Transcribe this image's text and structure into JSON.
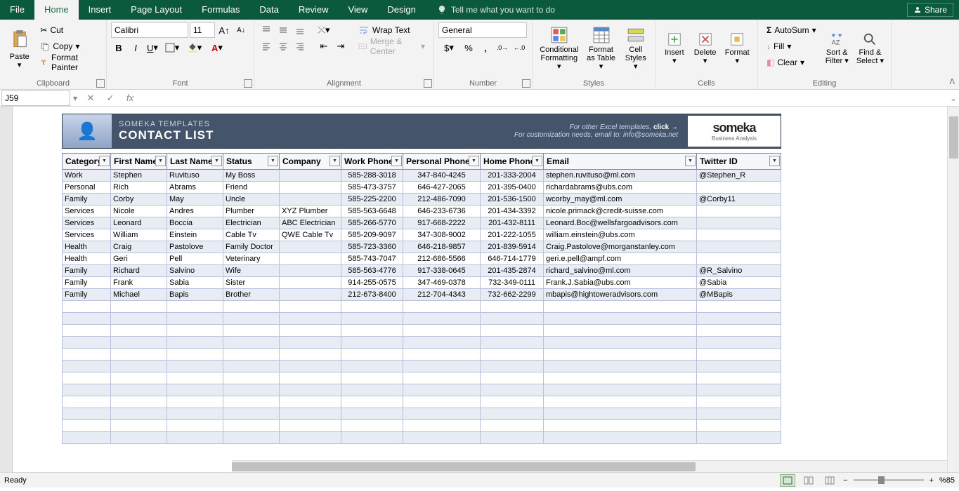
{
  "titlebar": {
    "tabs": [
      "File",
      "Home",
      "Insert",
      "Page Layout",
      "Formulas",
      "Data",
      "Review",
      "View",
      "Design"
    ],
    "active_tab": "Home",
    "tellme": "Tell me what you want to do",
    "share": "Share"
  },
  "ribbon": {
    "clipboard": {
      "paste": "Paste",
      "cut": "Cut",
      "copy": "Copy",
      "format_painter": "Format Painter",
      "label": "Clipboard"
    },
    "font": {
      "name": "Calibri",
      "size": "11",
      "label": "Font"
    },
    "alignment": {
      "wrap": "Wrap Text",
      "merge": "Merge & Center",
      "label": "Alignment"
    },
    "number": {
      "format": "General",
      "label": "Number"
    },
    "styles": {
      "cond": "Conditional Formatting",
      "table": "Format as Table",
      "cell": "Cell Styles",
      "label": "Styles"
    },
    "cells": {
      "insert": "Insert",
      "delete": "Delete",
      "format": "Format",
      "label": "Cells"
    },
    "editing": {
      "autosum": "AutoSum",
      "fill": "Fill",
      "clear": "Clear",
      "sort": "Sort & Filter",
      "find": "Find & Select",
      "label": "Editing"
    }
  },
  "formula_bar": {
    "namebox": "J59",
    "formula": ""
  },
  "banner": {
    "sub": "SOMEKA TEMPLATES",
    "main": "CONTACT LIST",
    "line1_pre": "For other Excel templates, ",
    "line1_link": "click →",
    "line2": "For customization needs, email to: info@someka.net",
    "logo_t1": "someka",
    "logo_t2": "Business Analysis"
  },
  "headers": [
    "Category",
    "First Name",
    "Last Name",
    "Status",
    "Company",
    "Work Phone",
    "Personal Phone",
    "Home Phone",
    "Email",
    "Twitter ID"
  ],
  "rows": [
    {
      "cat": "Work",
      "fn": "Stephen",
      "ln": "Ruvituso",
      "st": "My Boss",
      "co": "",
      "wp": "585-288-3018",
      "pp": "347-840-4245",
      "hp": "201-333-2004",
      "em": "stephen.ruvituso@ml.com",
      "tw": "@Stephen_R"
    },
    {
      "cat": "Personal",
      "fn": "Rich",
      "ln": "Abrams",
      "st": "Friend",
      "co": "",
      "wp": "585-473-3757",
      "pp": "646-427-2065",
      "hp": "201-395-0400",
      "em": "richardabrams@ubs.com",
      "tw": ""
    },
    {
      "cat": "Family",
      "fn": "Corby",
      "ln": "May",
      "st": "Uncle",
      "co": "",
      "wp": "585-225-2200",
      "pp": "212-486-7090",
      "hp": "201-536-1500",
      "em": "wcorby_may@ml.com",
      "tw": "@Corby11"
    },
    {
      "cat": "Services",
      "fn": "Nicole",
      "ln": "Andres",
      "st": "Plumber",
      "co": "XYZ Plumber",
      "wp": "585-563-6648",
      "pp": "646-233-6736",
      "hp": "201-434-3392",
      "em": "nicole.primack@credit-suisse.com",
      "tw": ""
    },
    {
      "cat": "Services",
      "fn": "Leonard",
      "ln": "Boccia",
      "st": "Electrician",
      "co": "ABC Electrician",
      "wp": "585-266-5770",
      "pp": "917-668-2222",
      "hp": "201-432-8111",
      "em": "Leonard.Boc@wellsfargoadvisors.com",
      "tw": ""
    },
    {
      "cat": "Services",
      "fn": "William",
      "ln": "Einstein",
      "st": "Cable Tv",
      "co": "QWE Cable Tv",
      "wp": "585-209-9097",
      "pp": "347-308-9002",
      "hp": "201-222-1055",
      "em": "william.einstein@ubs.com",
      "tw": ""
    },
    {
      "cat": "Health",
      "fn": "Craig",
      "ln": "Pastolove",
      "st": "Family Doctor",
      "co": "",
      "wp": "585-723-3360",
      "pp": "646-218-9857",
      "hp": "201-839-5914",
      "em": "Craig.Pastolove@morganstanley.com",
      "tw": ""
    },
    {
      "cat": "Health",
      "fn": "Geri",
      "ln": "Pell",
      "st": "Veterinary",
      "co": "",
      "wp": "585-743-7047",
      "pp": "212-686-5566",
      "hp": "646-714-1779",
      "em": "geri.e.pell@ampf.com",
      "tw": ""
    },
    {
      "cat": "Family",
      "fn": "Richard",
      "ln": "Salvino",
      "st": "Wife",
      "co": "",
      "wp": "585-563-4776",
      "pp": "917-338-0645",
      "hp": "201-435-2874",
      "em": "richard_salvino@ml.com",
      "tw": "@R_Salvino"
    },
    {
      "cat": "Family",
      "fn": "Frank",
      "ln": "Sabia",
      "st": "Sister",
      "co": "",
      "wp": "914-255-0575",
      "pp": "347-469-0378",
      "hp": "732-349-0111",
      "em": "Frank.J.Sabia@ubs.com",
      "tw": "@Sabia"
    },
    {
      "cat": "Family",
      "fn": "Michael",
      "ln": "Bapis",
      "st": "Brother",
      "co": "",
      "wp": "212-673-8400",
      "pp": "212-704-4343",
      "hp": "732-662-2299",
      "em": "mbapis@hightoweradvisors.com",
      "tw": "@MBapis"
    }
  ],
  "empty_rows": 12,
  "statusbar": {
    "ready": "Ready",
    "zoom": "%85"
  }
}
